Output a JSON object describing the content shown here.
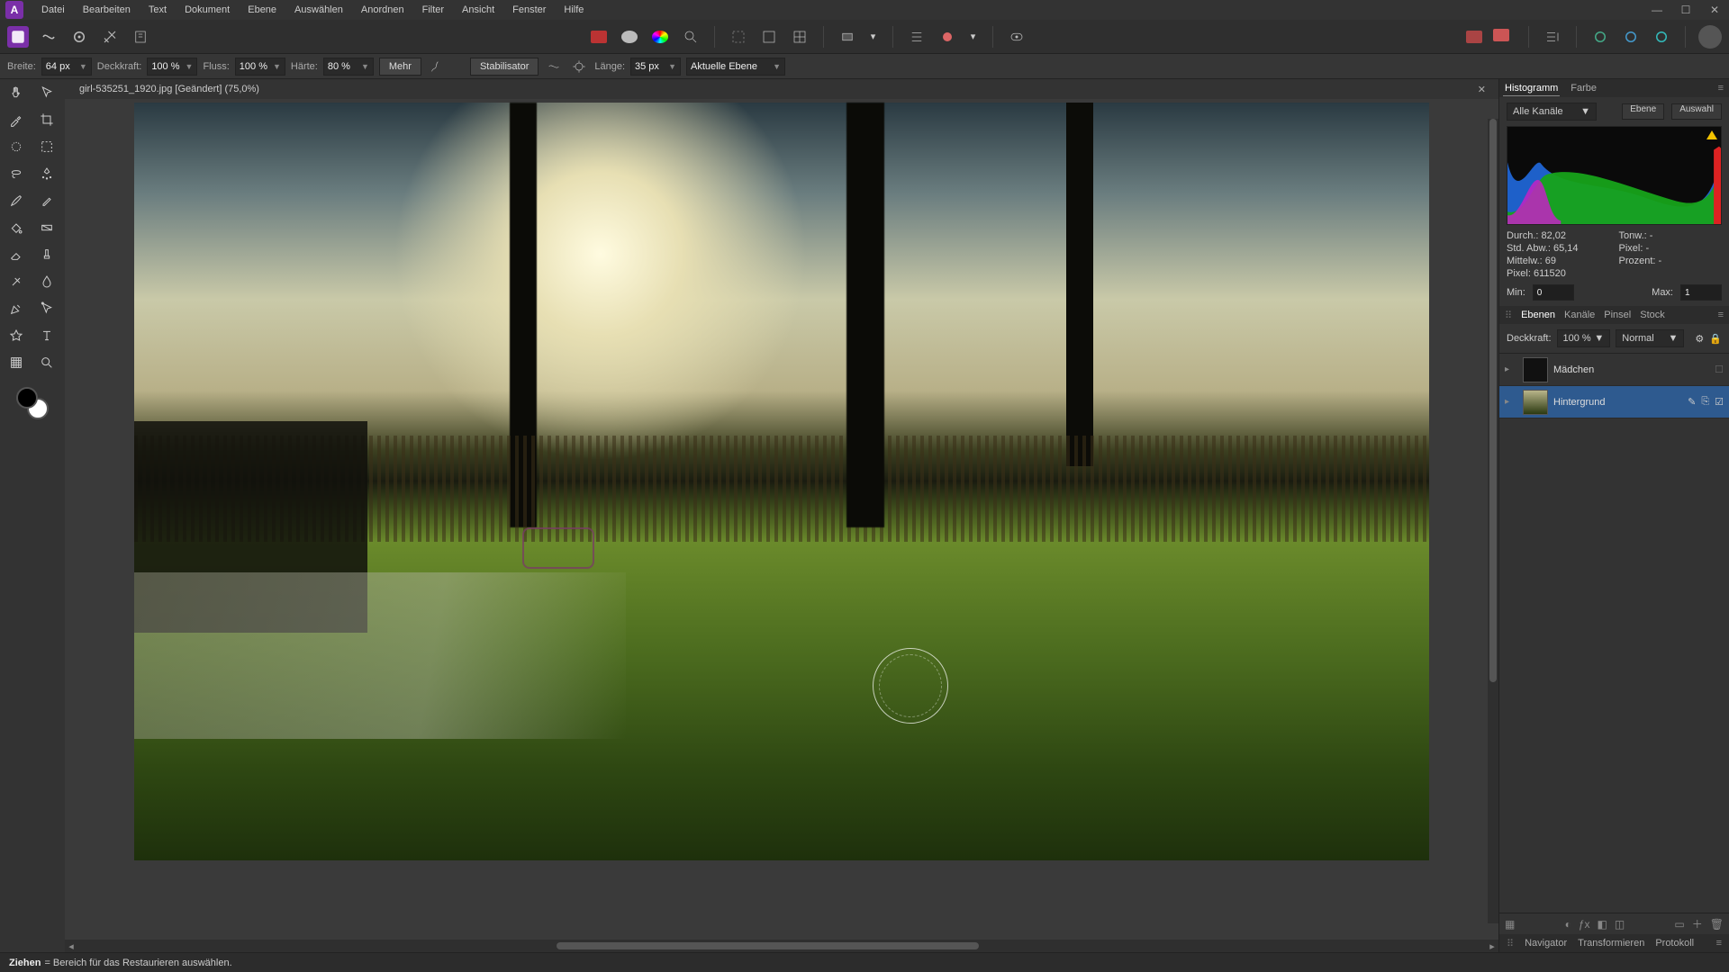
{
  "menu": {
    "items": [
      "Datei",
      "Bearbeiten",
      "Text",
      "Dokument",
      "Ebene",
      "Auswählen",
      "Anordnen",
      "Filter",
      "Ansicht",
      "Fenster",
      "Hilfe"
    ]
  },
  "context": {
    "breite_label": "Breite:",
    "breite_value": "64 px",
    "deck_label": "Deckkraft:",
    "deck_value": "100 %",
    "fluss_label": "Fluss:",
    "fluss_value": "100 %",
    "haerte_label": "Härte:",
    "haerte_value": "80 %",
    "mehr": "Mehr",
    "stabil": "Stabilisator",
    "laenge_label": "Länge:",
    "laenge_value": "35 px",
    "aktuelle": "Aktuelle Ebene"
  },
  "document": {
    "tab_title": "girl-535251_1920.jpg [Geändert] (75,0%)"
  },
  "panels": {
    "hist_tab": "Histogramm",
    "color_tab": "Farbe",
    "channel_value": "Alle Kanäle",
    "ebene_btn": "Ebene",
    "auswahl_btn": "Auswahl",
    "stat_durch": "Durch.: 82,02",
    "stat_tonw": "Tonw.: -",
    "stat_std": "Std. Abw.: 65,14",
    "stat_pixel2": "Pixel: -",
    "stat_mittel": "Mittelw.: 69",
    "stat_prozent": "Prozent: -",
    "stat_pixel": "Pixel: 611520",
    "min_label": "Min:",
    "min_value": "0",
    "max_label": "Max:",
    "max_value": "1",
    "layers_tabs": [
      "Ebenen",
      "Kanäle",
      "Pinsel",
      "Stock"
    ],
    "deck_label": "Deckkraft:",
    "deck_value": "100 %",
    "blend_value": "Normal",
    "layer1": "Mädchen",
    "layer2": "Hintergrund",
    "nav_tabs": [
      "Navigator",
      "Transformieren",
      "Protokoll"
    ]
  },
  "status": {
    "action": "Ziehen",
    "hint": " = Bereich für das Restaurieren auswählen."
  }
}
